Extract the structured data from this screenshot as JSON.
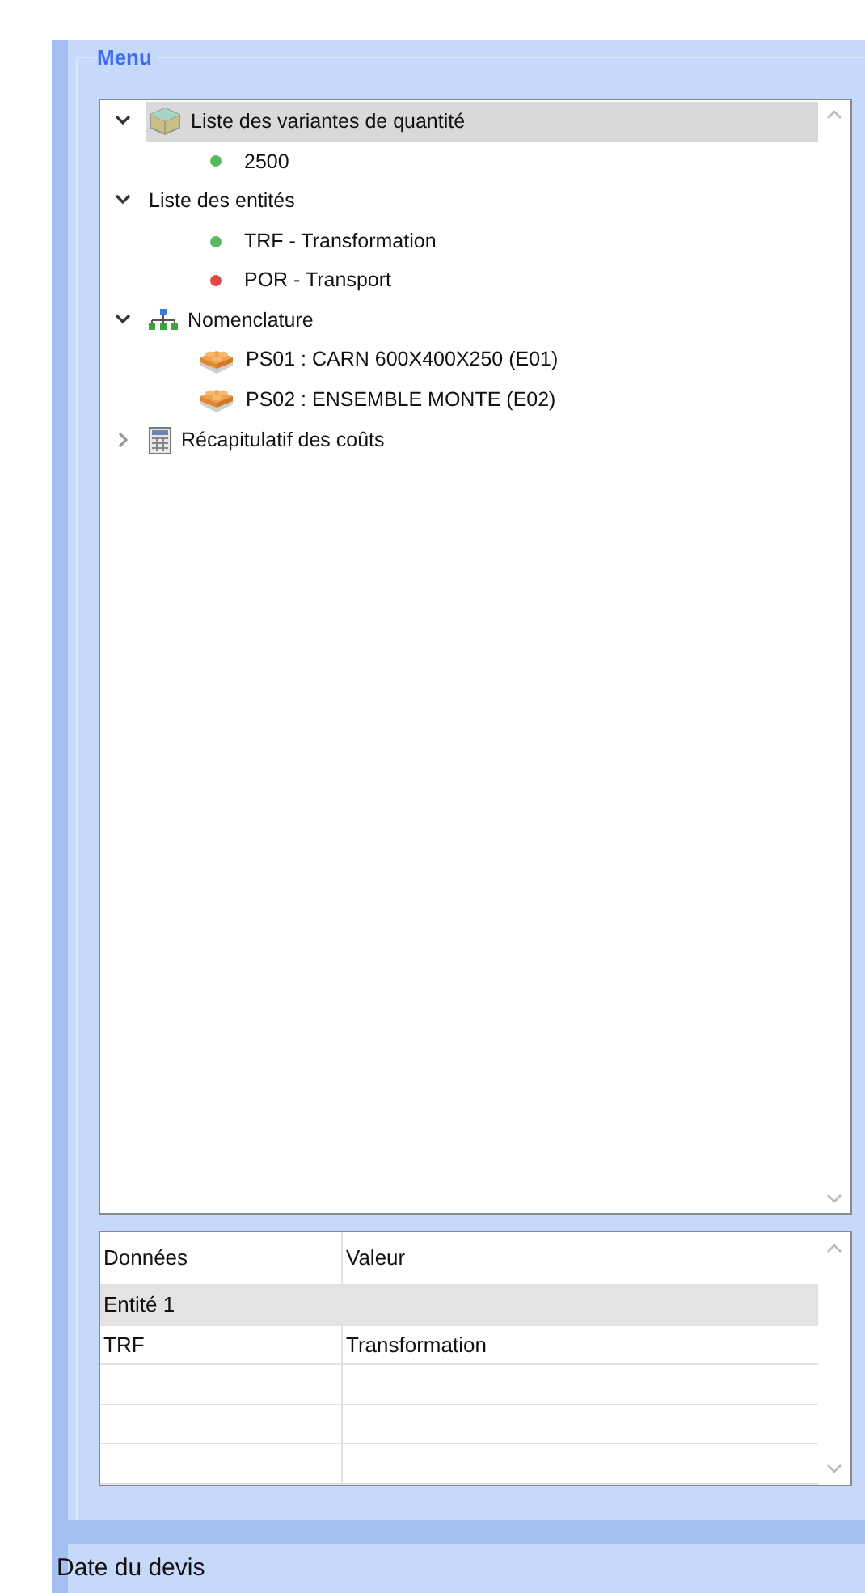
{
  "menu": {
    "title": "Menu",
    "tree": [
      {
        "label": "Liste des variantes de quantité",
        "kind": "box",
        "expanded": true,
        "selected": true,
        "children": [
          {
            "label": "2500",
            "kind": "dot",
            "color": "#5cb85c",
            "selected": false
          }
        ]
      },
      {
        "label": "Liste des entités",
        "kind": "plain",
        "expanded": true,
        "selected": false,
        "children": [
          {
            "label": "TRF - Transformation",
            "kind": "dot",
            "color": "#5cb85c",
            "selected": false
          },
          {
            "label": "POR - Transport",
            "kind": "dot",
            "color": "#e04848",
            "selected": false
          }
        ]
      },
      {
        "label": "Nomenclature",
        "kind": "hierarchy",
        "expanded": true,
        "selected": false,
        "children": [
          {
            "label": "PS01 : CARN 600X400X250 (E01)",
            "kind": "brick",
            "selected": false
          },
          {
            "label": "PS02 : ENSEMBLE MONTE (E02)",
            "kind": "brick",
            "selected": false
          }
        ]
      },
      {
        "label": "Récapitulatif des coûts",
        "kind": "calculator",
        "expanded": false,
        "selected": false
      }
    ],
    "table": {
      "columns": [
        "Données",
        "Valeur"
      ],
      "rows": [
        {
          "kind": "group",
          "cells": [
            "Entité 1"
          ]
        },
        {
          "kind": "data",
          "cells": [
            "TRF",
            "Transformation"
          ]
        },
        {
          "kind": "empty"
        },
        {
          "kind": "empty"
        },
        {
          "kind": "empty"
        }
      ]
    }
  },
  "status_label": "Date du devis"
}
